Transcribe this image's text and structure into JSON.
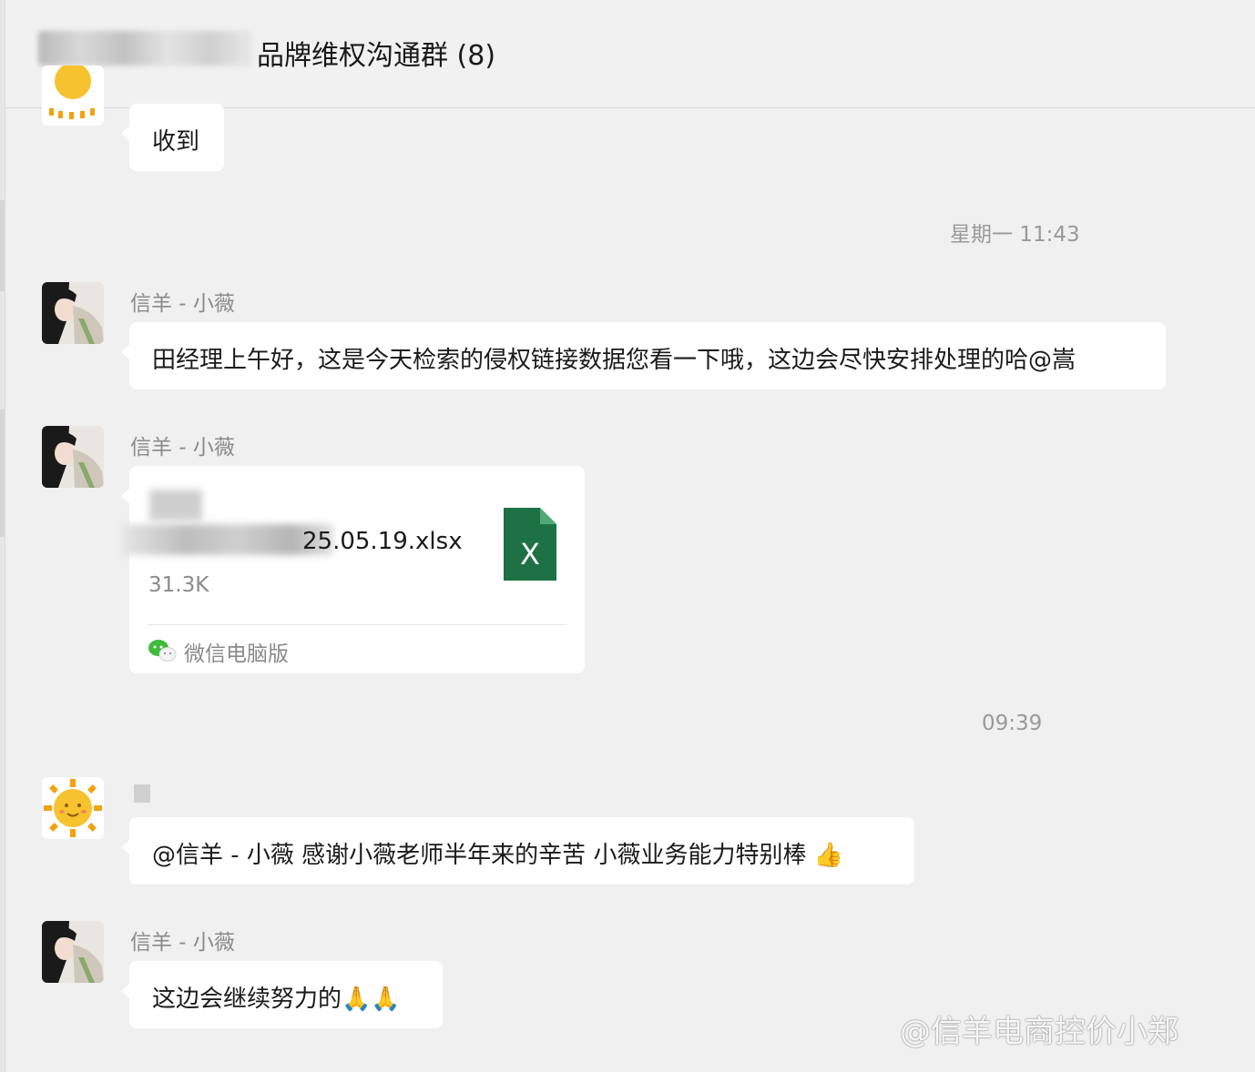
{
  "header": {
    "title": "品牌维权沟通群 (8)"
  },
  "messages": [
    {
      "sender": "",
      "text": "收到"
    },
    {
      "timestamp": "星期一 11:43"
    },
    {
      "sender": "信羊 - 小薇",
      "text": "田经理上午好，这是今天检索的侵权链接数据您看一下哦，这边会尽快安排处理的哈@嵩"
    },
    {
      "sender": "信羊 - 小薇",
      "file": {
        "name": "25.05.19.xlsx",
        "size": "31.3K",
        "source": "微信电脑版",
        "icon_letter": "X",
        "icon_color": "#1e7145"
      }
    },
    {
      "timestamp": "09:39"
    },
    {
      "sender": "",
      "text": "@信羊 - 小薇  感谢小薇老师半年来的辛苦 小薇业务能力特别棒 👍"
    },
    {
      "sender": "信羊 - 小薇",
      "text": "这边会继续努力的🙏🙏"
    }
  ],
  "watermark": "@信羊电商控价小郑",
  "colors": {
    "background": "#f0f0f0",
    "bubble": "#ffffff",
    "meta_text": "#8a8a8a",
    "excel_green": "#1e7145"
  }
}
